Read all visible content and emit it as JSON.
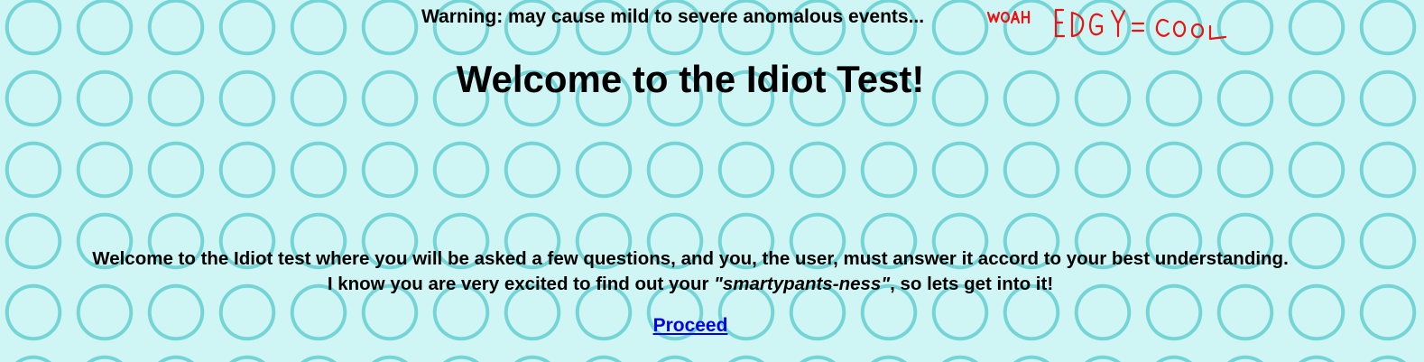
{
  "warning": "Warning: may cause mild to severe anomalous events...",
  "scribble": "WOAH EDGY=COOL",
  "title": "Welcome to the Idiot Test!",
  "intro": {
    "line1": "Welcome to the Idiot test where you will be asked a few questions, and you, the user, must answer it accord to your best understanding.",
    "line2_prefix": "I know you are very excited to find out your ",
    "line2_emphasis": "\"smartypants-ness\"",
    "line2_suffix": ", so lets get into it!"
  },
  "proceed_label": "Proceed",
  "colors": {
    "background": "#cff6f5",
    "circle_pattern": "#74d4d6",
    "scribble": "#ee1111",
    "link": "#0000ee"
  }
}
